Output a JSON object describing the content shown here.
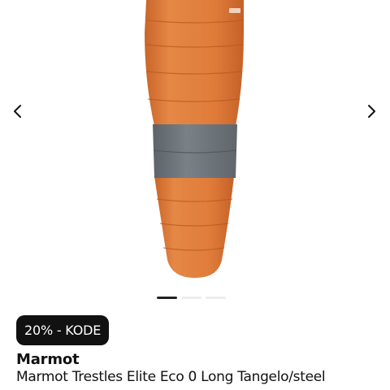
{
  "gallery": {
    "image": "sleeping-bag-product-image",
    "prev_icon": "chevron-left-icon",
    "next_icon": "chevron-right-icon",
    "pagination": {
      "total": 3,
      "active": 1
    }
  },
  "badge": {
    "label": "20% - KODE"
  },
  "product": {
    "brand": "Marmot",
    "title": "Marmot Trestles Elite Eco 0 Long Tangelo/steel"
  },
  "colors": {
    "badge_bg": "#111111",
    "bag_orange": "#df7a38",
    "bag_gray": "#737a80"
  }
}
